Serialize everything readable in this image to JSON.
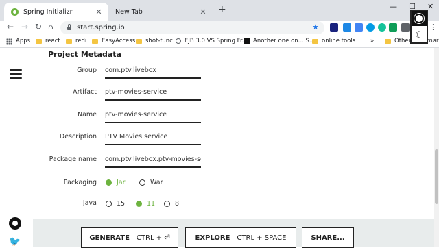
{
  "browser": {
    "tabs": [
      {
        "title": "Spring Initializr",
        "active": true
      },
      {
        "title": "New Tab",
        "active": false
      }
    ],
    "url": "start.spring.io",
    "bookmarks": [
      "Apps",
      "react",
      "redi",
      "EasyAccess",
      "shot-func",
      "EJB 3.0 VS Spring Fr...",
      "Another one on... S...",
      "online tools",
      "Other bookmarks"
    ],
    "more_bookmarks": "»"
  },
  "metadata": {
    "section_title": "Project Metadata",
    "fields": [
      {
        "label": "Group",
        "value": "com.ptv.livebox"
      },
      {
        "label": "Artifact",
        "value": "ptv-movies-service"
      },
      {
        "label": "Name",
        "value": "ptv-movies-service"
      },
      {
        "label": "Description",
        "value": "PTV Movies service"
      },
      {
        "label": "Package name",
        "value": "com.ptv.livebox.ptv-movies-service"
      }
    ],
    "packaging": {
      "label": "Packaging",
      "options": [
        "Jar",
        "War"
      ],
      "selected": "Jar"
    },
    "java": {
      "label": "Java",
      "options": [
        "15",
        "11",
        "8"
      ],
      "selected": "11"
    }
  },
  "footer": {
    "generate": {
      "label": "GENERATE",
      "shortcut": "CTRL + ⏎"
    },
    "explore": {
      "label": "EXPLORE",
      "shortcut": "CTRL + SPACE"
    },
    "share": {
      "label": "SHARE..."
    }
  },
  "colors": {
    "accent": "#6db33f",
    "footer_bg": "#e8ecec"
  }
}
